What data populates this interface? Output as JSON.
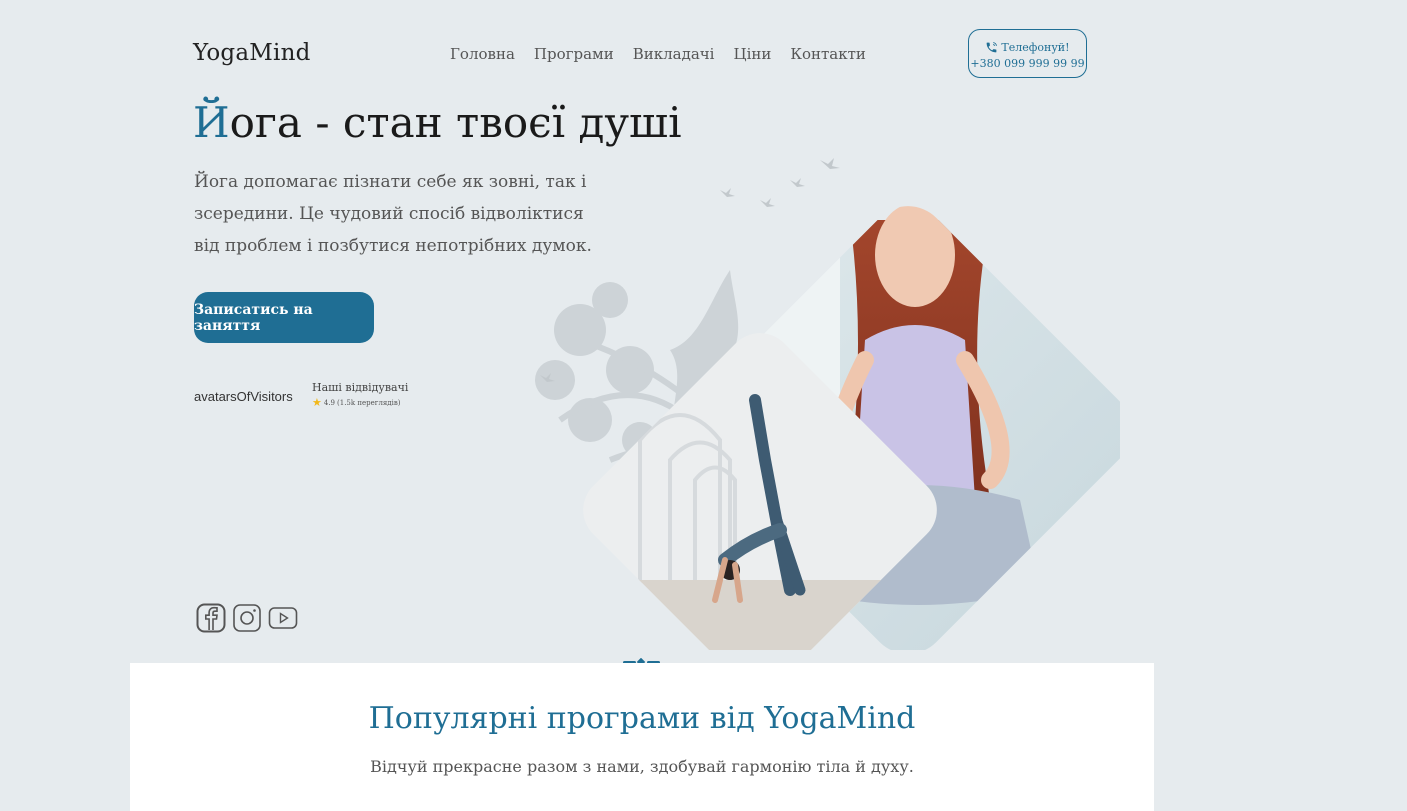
{
  "header": {
    "logo": "YogaMind",
    "nav": [
      "Головна",
      "Програми",
      "Викладачі",
      "Ціни",
      "Контакти"
    ],
    "phone_label": "Телефонуй!",
    "phone_number": "+380 099 999 99 99"
  },
  "hero": {
    "title_accent": "Й",
    "title_rest": "ога - стан твоєї душі",
    "text": "Йога допомагає пізнати себе як зовні, так і зсередини. Це чудовий спосіб відволіктися від проблем і позбутися непотрібних думок.",
    "cta": "Записатись на заняття",
    "avatars_alt": "avatarsOfVisitors",
    "visitors_title": "Наші відвідувачі",
    "rating": "4.9",
    "views": "(1.5k переглядів)"
  },
  "social": [
    "facebook-icon",
    "instagram-icon",
    "youtube-icon"
  ],
  "section": {
    "title": "Популярні програми від YogaMind",
    "subtitle": "Відчуй прекрасне разом з нами, здобувай гармонію тіла й духу."
  },
  "colors": {
    "accent": "#1f6e94",
    "background": "#e6ebee"
  }
}
